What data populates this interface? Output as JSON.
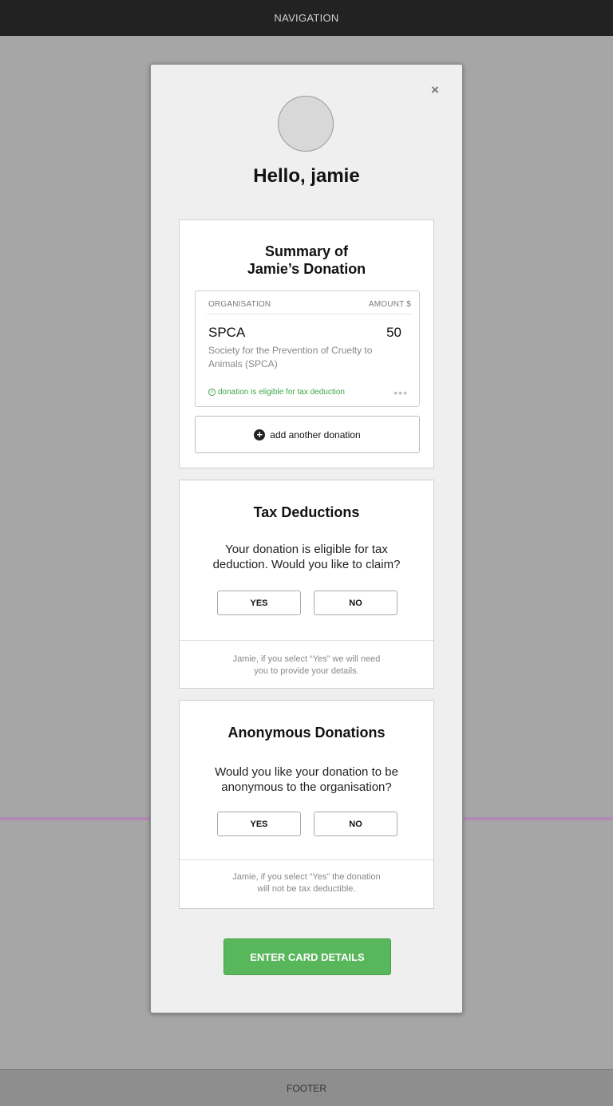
{
  "nav": {
    "label": "NAVIGATION"
  },
  "footer": {
    "label": "FOOTER"
  },
  "modal": {
    "close_symbol": "×",
    "greeting": "Hello, jamie",
    "summary": {
      "title_line1": "Summary of",
      "title_line2": "Jamie’s Donation",
      "col_organisation": "ORGANISATION",
      "col_amount": "AMOUNT $",
      "donation": {
        "org": "SPCA",
        "amount": "50",
        "description": "Society for the Prevention of Cruelty to Animals (SPCA)",
        "eligibility": "donation is eligible for tax deduction"
      },
      "add_label": "add another donation"
    },
    "tax": {
      "title": "Tax Deductions",
      "question_line1": "Your donation is eligible for tax",
      "question_line2": "deduction. Would you like to claim?",
      "yes": "YES",
      "no": "NO",
      "note_line1": "Jamie, if you select “Yes” we will need",
      "note_line2": "you to provide your details."
    },
    "anonymous": {
      "title": "Anonymous Donations",
      "question_line1": "Would you like your donation to be",
      "question_line2": "anonymous to the organisation?",
      "yes": "YES",
      "no": "NO",
      "note_line1": "Jamie, if you select “Yes” the donation",
      "note_line2": "will not be tax deductible."
    },
    "cta_label": "ENTER CARD DETAILS"
  },
  "colors": {
    "accent_green": "#58b65b",
    "eligible_green": "#3fa64a",
    "navbar": "#222222",
    "backdrop": "#a6a6a6"
  },
  "icons": [
    "close-icon",
    "avatar",
    "check-circle-icon",
    "more-icon",
    "plus-circle-icon"
  ]
}
